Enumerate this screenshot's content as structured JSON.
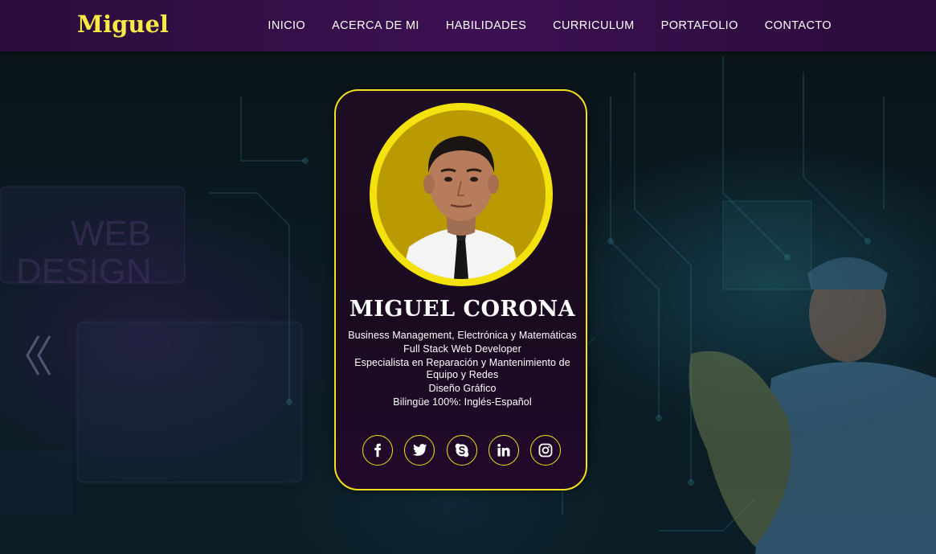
{
  "header": {
    "brand": "Miguel",
    "nav": [
      {
        "label": "INICIO"
      },
      {
        "label": "ACERCA DE MI"
      },
      {
        "label": "HABILIDADES"
      },
      {
        "label": "CURRICULUM"
      },
      {
        "label": "PORTAFOLIO"
      },
      {
        "label": "CONTACTO"
      }
    ]
  },
  "hero": {
    "background_text": [
      "WEB",
      "DESIGN"
    ],
    "prev_icon": "double-chevron-left-icon"
  },
  "card": {
    "name": "MIGUEL CORONA",
    "roles": [
      "Business Management, Electrónica y Matemáticas",
      "Full Stack Web Developer",
      "Especialista en Reparación y Mantenimiento de Equipo y Redes",
      "Diseño Gráfico",
      "Bilingüe 100%: Inglés-Español"
    ],
    "socials": [
      {
        "icon": "facebook-icon"
      },
      {
        "icon": "twitter-icon"
      },
      {
        "icon": "skype-icon"
      },
      {
        "icon": "linkedin-icon"
      },
      {
        "icon": "instagram-icon"
      }
    ]
  },
  "colors": {
    "accent": "#f4df1c",
    "brand": "#f7ea47",
    "nav_bg": "#3c1052",
    "card_bg": "#1e0e24"
  }
}
